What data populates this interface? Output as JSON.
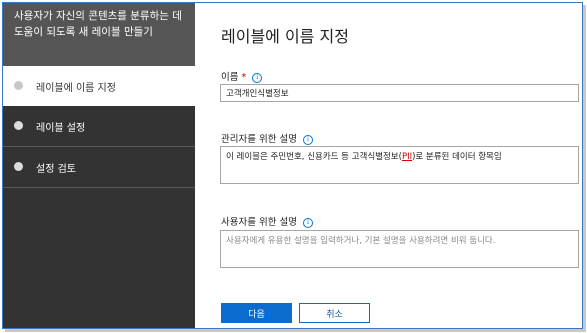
{
  "sidebar": {
    "header": "사용자가 자신의 콘텐츠를 분류하는 데 도움이 되도록 새 레이블 만들기",
    "steps": [
      {
        "label": "레이블에 이름 지정",
        "active": true
      },
      {
        "label": "레이블 설정",
        "active": false
      },
      {
        "label": "설정 검토",
        "active": false
      }
    ]
  },
  "main": {
    "title": "레이블에 이름 지정",
    "name_label": "이름",
    "required_mark": "*",
    "name_value": "고객개인식별정보",
    "admin_desc_label": "관리자를 위한 설명",
    "admin_desc_prefix": "이 레이블은 주민번호, 신용카드 등 고객식별정보(",
    "admin_desc_pii": "PII",
    "admin_desc_suffix": ")로 분류된 데이터 항목임",
    "user_desc_label": "사용자를 위한 설명",
    "user_desc_placeholder": "사용자에게 유용한 설명을 입력하거나, 기본 설명을 사용하려면 비워 둡니다.",
    "info_glyph": "i"
  },
  "buttons": {
    "next": "다음",
    "cancel": "취소"
  }
}
